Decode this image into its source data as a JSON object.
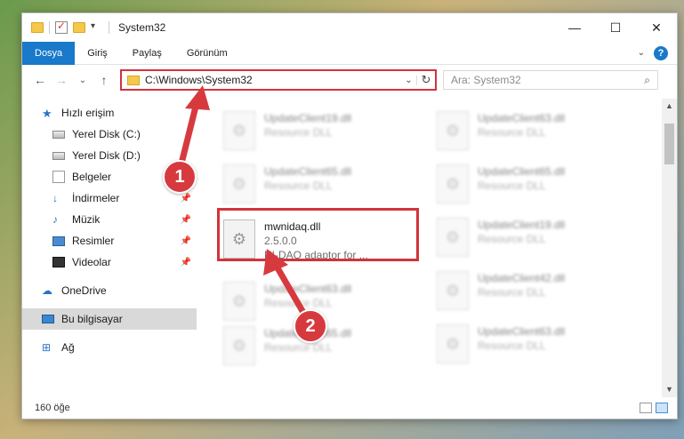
{
  "window": {
    "title": "System32",
    "controls": {
      "minimize": "—",
      "maximize": "☐",
      "close": "✕"
    }
  },
  "ribbon": {
    "tabs": [
      "Dosya",
      "Giriş",
      "Paylaş",
      "Görünüm"
    ],
    "help": "?"
  },
  "nav": {
    "back": "←",
    "forward": "→",
    "recent": "⌄",
    "up": "↑",
    "address": "C:\\Windows\\System32",
    "search_placeholder": "Ara: System32"
  },
  "sidebar": {
    "items": [
      {
        "label": "Hızlı erişim",
        "icon": "star-icon"
      },
      {
        "label": "Yerel Disk (C:)",
        "icon": "disk-icon"
      },
      {
        "label": "Yerel Disk (D:)",
        "icon": "disk-icon"
      },
      {
        "label": "Belgeler",
        "icon": "documents-icon"
      },
      {
        "label": "İndirmeler",
        "icon": "download-icon"
      },
      {
        "label": "Müzik",
        "icon": "music-icon"
      },
      {
        "label": "Resimler",
        "icon": "pictures-icon"
      },
      {
        "label": "Videolar",
        "icon": "videos-icon"
      },
      {
        "label": "OneDrive",
        "icon": "cloud-icon"
      },
      {
        "label": "Bu bilgisayar",
        "icon": "computer-icon"
      },
      {
        "label": "Ağ",
        "icon": "network-icon"
      }
    ]
  },
  "files": {
    "left": [
      {
        "name": "UpdateClient19.dll",
        "sub": "Resource DLL"
      },
      {
        "name": "UpdateClient65.dll",
        "sub": "Resource DLL"
      },
      {
        "name": "mwnidaq.dll",
        "version": "2.5.0.0",
        "desc": "NI-DAQ adaptor for ..."
      },
      {
        "name": "UpdateClient63.dll",
        "sub": "Resource DLL"
      },
      {
        "name": "UpdateClient65.dll",
        "sub": "Resource DLL"
      }
    ],
    "right": [
      {
        "name": "UpdateClient63.dll",
        "sub": "Resource DLL"
      },
      {
        "name": "UpdateClient65.dll",
        "sub": "Resource DLL"
      },
      {
        "name": "UpdateClient19.dll",
        "sub": "Resource DLL"
      },
      {
        "name": "UpdateClient42.dll",
        "sub": "Resource DLL"
      },
      {
        "name": "UpdateClient63.dll",
        "sub": "Resource DLL"
      }
    ]
  },
  "status": {
    "count": "160 öğe"
  },
  "annotations": {
    "step1": "1",
    "step2": "2",
    "color": "#d63a3f"
  }
}
